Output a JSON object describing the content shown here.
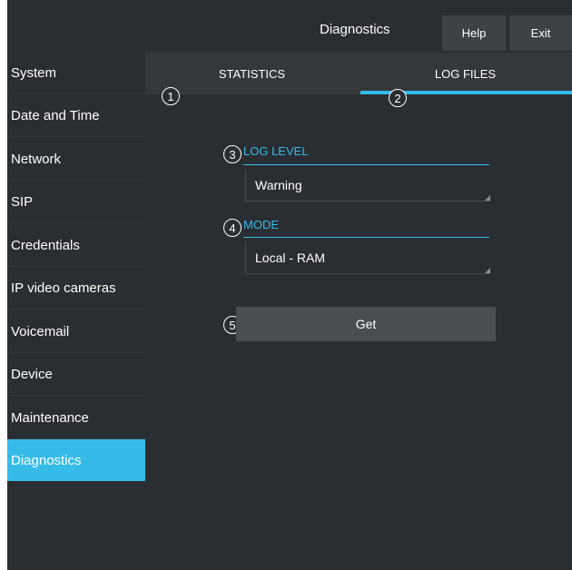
{
  "header": {
    "title": "Diagnostics",
    "help_label": "Help",
    "exit_label": "Exit"
  },
  "sidebar": {
    "items": [
      {
        "label": "System"
      },
      {
        "label": "Date and Time"
      },
      {
        "label": "Network"
      },
      {
        "label": "SIP"
      },
      {
        "label": "Credentials"
      },
      {
        "label": "IP video cameras"
      },
      {
        "label": "Voicemail"
      },
      {
        "label": "Device"
      },
      {
        "label": "Maintenance"
      },
      {
        "label": "Diagnostics"
      }
    ],
    "active_item": "Diagnostics"
  },
  "tabs": [
    {
      "label": "STATISTICS"
    },
    {
      "label": "LOG FILES"
    }
  ],
  "active_tab": "LOG FILES",
  "markers": [
    "1",
    "2",
    "3",
    "4",
    "5"
  ],
  "log_level": {
    "label": "LOG LEVEL",
    "value": "Warning"
  },
  "mode": {
    "label": "MODE",
    "value": "Local - RAM"
  },
  "get_button": {
    "label": "Get"
  },
  "colors": {
    "accent": "#36bbe8",
    "background": "#2a2d31",
    "tab_bar": "#34373c",
    "button": "#4a4d52"
  }
}
